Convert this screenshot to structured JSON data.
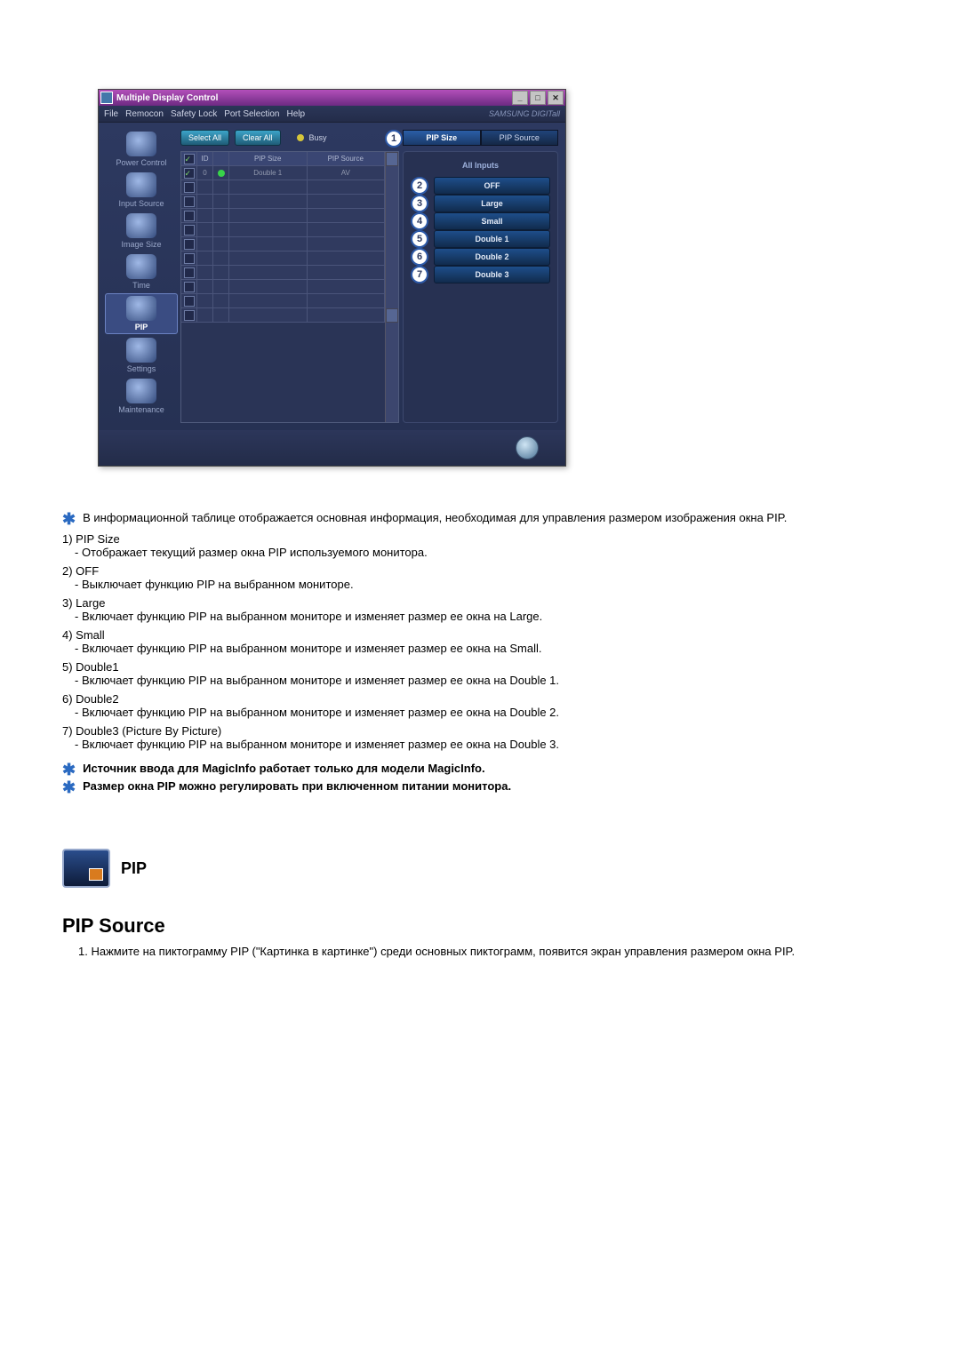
{
  "app": {
    "window_title": "Multiple Display Control",
    "menus": [
      "File",
      "Remocon",
      "Safety Lock",
      "Port Selection",
      "Help"
    ],
    "brand": "SAMSUNG DIGITall",
    "left_nav": [
      {
        "label": "Power Control"
      },
      {
        "label": "Input Source"
      },
      {
        "label": "Image Size"
      },
      {
        "label": "Time"
      },
      {
        "label": "PIP",
        "selected": true
      },
      {
        "label": "Settings"
      },
      {
        "label": "Maintenance"
      }
    ],
    "toolbar": {
      "select_all": "Select All",
      "clear_all": "Clear All",
      "busy": "Busy"
    },
    "table": {
      "col_id": "ID",
      "col_pip_size": "PIP Size",
      "col_pip_source": "PIP Source",
      "rows": [
        {
          "checked": true,
          "id": "0",
          "status": "green",
          "pip_size": "Double 1",
          "pip_source": "AV"
        },
        {
          "checked": false,
          "id": "",
          "status": "",
          "pip_size": "",
          "pip_source": ""
        },
        {
          "checked": false,
          "id": "",
          "status": "",
          "pip_size": "",
          "pip_source": ""
        },
        {
          "checked": false,
          "id": "",
          "status": "",
          "pip_size": "",
          "pip_source": ""
        },
        {
          "checked": false,
          "id": "",
          "status": "",
          "pip_size": "",
          "pip_source": ""
        },
        {
          "checked": false,
          "id": "",
          "status": "",
          "pip_size": "",
          "pip_source": ""
        },
        {
          "checked": false,
          "id": "",
          "status": "",
          "pip_size": "",
          "pip_source": ""
        },
        {
          "checked": false,
          "id": "",
          "status": "",
          "pip_size": "",
          "pip_source": ""
        },
        {
          "checked": false,
          "id": "",
          "status": "",
          "pip_size": "",
          "pip_source": ""
        },
        {
          "checked": false,
          "id": "",
          "status": "",
          "pip_size": "",
          "pip_source": ""
        },
        {
          "checked": false,
          "id": "",
          "status": "",
          "pip_size": "",
          "pip_source": ""
        }
      ]
    },
    "right_panel": {
      "tab_callout": "1",
      "tabs": {
        "pip_size": "PIP Size",
        "pip_source": "PIP Source"
      },
      "all_inputs": "All Inputs",
      "options": [
        {
          "callout": "2",
          "label": "OFF"
        },
        {
          "callout": "3",
          "label": "Large"
        },
        {
          "callout": "4",
          "label": "Small"
        },
        {
          "callout": "5",
          "label": "Double 1"
        },
        {
          "callout": "6",
          "label": "Double 2"
        },
        {
          "callout": "7",
          "label": "Double 3"
        }
      ]
    }
  },
  "doc": {
    "star_intro": "В информационной таблице отображается основная информация, необходимая для управления размером изображения окна PIP.",
    "items": [
      {
        "num": "1)",
        "title": "PIP Size",
        "desc": "- Отображает текущий размер окна PIP используемого монитора."
      },
      {
        "num": "2)",
        "title": "OFF",
        "desc": "- Выключает функцию PIP на выбранном мониторе."
      },
      {
        "num": "3)",
        "title": "Large",
        "desc": "- Включает функцию PIP на выбранном мониторе и изменяет размер ее окна на Large."
      },
      {
        "num": "4)",
        "title": "Small",
        "desc": "- Включает функцию PIP на выбранном мониторе и изменяет размер ее окна на Small."
      },
      {
        "num": "5)",
        "title": "Double1",
        "desc": "- Включает функцию PIP на выбранном мониторе и изменяет размер ее окна на Double 1."
      },
      {
        "num": "6)",
        "title": "Double2",
        "desc": "- Включает функцию PIP на выбранном мониторе и изменяет размер ее окна на Double 2."
      },
      {
        "num": "7)",
        "title": "Double3 (Picture By Picture)",
        "desc": "- Включает функцию PIP на выбранном мониторе и изменяет размер ее окна на Double 3."
      }
    ],
    "note1": "Источник ввода для MagicInfo работает только для модели MagicInfo.",
    "note2": "Размер окна PIP можно регулировать при включенном питании монитора.",
    "section_icon_label": "PIP",
    "section_heading": "PIP Source",
    "ol1_num": "1.",
    "ol1_text": "Нажмите на пиктограмму PIP (\"Картинка в картинке\") среди основных пиктограмм, появится экран управления размером окна PIP."
  }
}
